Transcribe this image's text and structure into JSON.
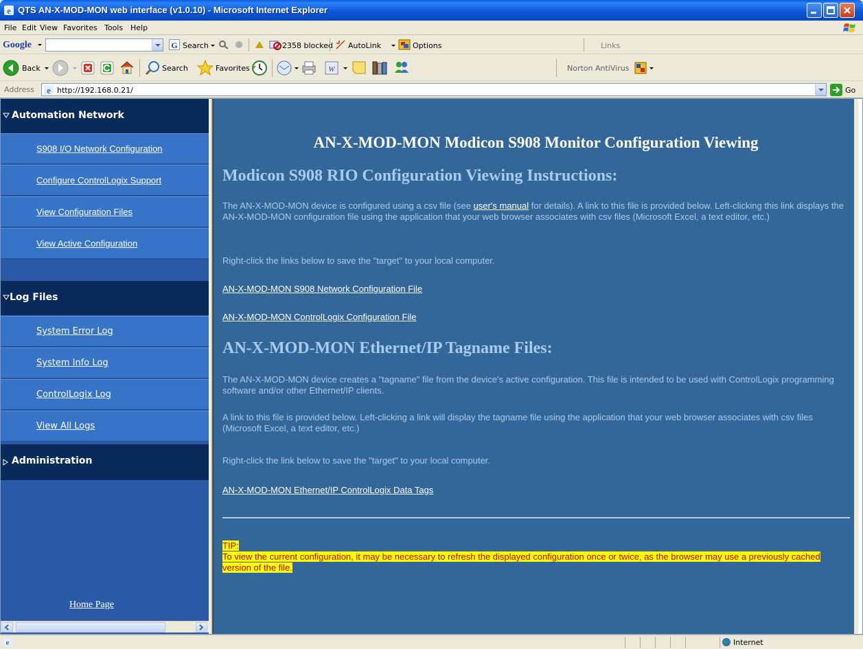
{
  "window": {
    "title": "QTS AN-X-MOD-MON web interface (v1.0.10) - Microsoft Internet Explorer"
  },
  "menu": [
    "File",
    "Edit",
    "View",
    "Favorites",
    "Tools",
    "Help"
  ],
  "google_toolbar": {
    "logo": "Google",
    "search_label": "Search",
    "blocked_label": "2358 blocked",
    "autolink_label": "AutoLink",
    "options_label": "Options",
    "links_label": "Links"
  },
  "std_toolbar": {
    "back_label": "Back",
    "search_label": "Search",
    "favorites_label": "Favorites",
    "norton_label": "Norton AntiVirus"
  },
  "address": {
    "label": "Address",
    "url": "http://192.168.0.21/",
    "go_label": "Go"
  },
  "sidebar": {
    "sections": [
      {
        "title": "Automation Network",
        "expanded": true,
        "items": [
          "S908 I/O Network Configuration",
          "Configure ControlLogix Support",
          "View Configuration Files",
          "View Active Configuration"
        ]
      },
      {
        "title": "Log Files",
        "expanded": true,
        "items": [
          "System Error Log",
          "System Info Log",
          "ControlLogix Log",
          "View All Logs"
        ]
      },
      {
        "title": "Administration",
        "expanded": false,
        "items": []
      }
    ],
    "home_link": "Home Page"
  },
  "main": {
    "page_title": "AN-X-MOD-MON Modicon S908 Monitor Configuration Viewing",
    "section1": {
      "heading": "Modicon S908 RIO Configuration Viewing Instructions:",
      "para1_before": "The AN-X-MOD-MON device is configured using a csv file (see ",
      "para1_link": "user's manual",
      "para1_after": " for details). A link to this file is provided below. Left-clicking this link displays the AN-X-MOD-MON configuration file using the application that your web browser associates with csv files (Microsoft Excel, a text editor, etc.)",
      "para2": "Right-click the links below to save the \"target\" to your local computer.",
      "link1": "AN-X-MOD-MON S908 Network Configuration File",
      "link2": "AN-X-MOD-MON ControlLogix Configuration File"
    },
    "section2": {
      "heading": "AN-X-MOD-MON Ethernet/IP Tagname Files:",
      "para1": "The AN-X-MOD-MON device creates a \"tagname\" file from the device's active configuration. This file is intended to be used with ControlLogix programming software and/or other Ethernet/IP clients.",
      "para2": "A link to this file is provided below. Left-clicking a link will display the tagname file using the application that your web browser associates with csv files (Microsoft Excel, a text editor, etc.)",
      "para3": "Right-click the link below to save the \"target\" to your local computer.",
      "link1": "AN-X-MOD-MON Ethernet/IP ControlLogix Data Tags"
    },
    "tip": {
      "label": "TIP:",
      "text": "To view the current configuration, it may be necessary to refresh the displayed configuration once or twice, as the browser may use a previously cached version of the file."
    }
  },
  "status": {
    "zone": "Internet"
  },
  "colors": {
    "main_bg": "#336699",
    "sidebar_header_bg": "#0a2a5c",
    "sidebar_item_bg": "#3773c6",
    "heading_color": "#a8cbf0",
    "tip_bg": "#ffff00",
    "tip_text": "#cc0000"
  }
}
